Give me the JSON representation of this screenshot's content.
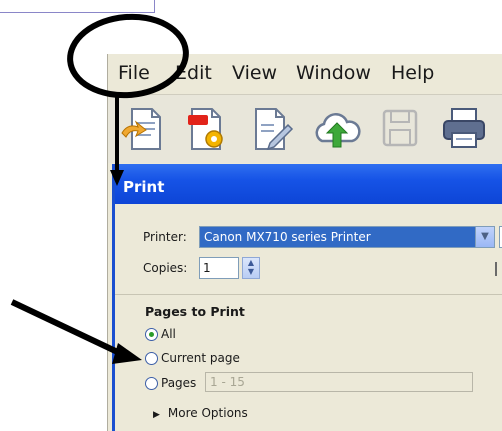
{
  "menu": {
    "items": [
      "File",
      "Edit",
      "View",
      "Window",
      "Help"
    ]
  },
  "toolbar": {
    "buttons": [
      "open-file-icon",
      "create-pdf-icon",
      "edit-document-icon",
      "cloud-upload-icon",
      "save-icon",
      "print-icon"
    ]
  },
  "dialog": {
    "title": "Print",
    "printer_label": "Printer:",
    "printer_value": "Canon MX710 series Printer",
    "copies_label": "Copies:",
    "copies_value": "1",
    "pages_to_print": {
      "title": "Pages to Print",
      "options": [
        "All",
        "Current page",
        "Pages"
      ],
      "selected": "All",
      "pages_range": "1 - 15"
    },
    "more_options_label": "More Options"
  },
  "colors": {
    "title_bar": "#1653e6",
    "selection": "#316ac5",
    "annotation": "#000000"
  }
}
